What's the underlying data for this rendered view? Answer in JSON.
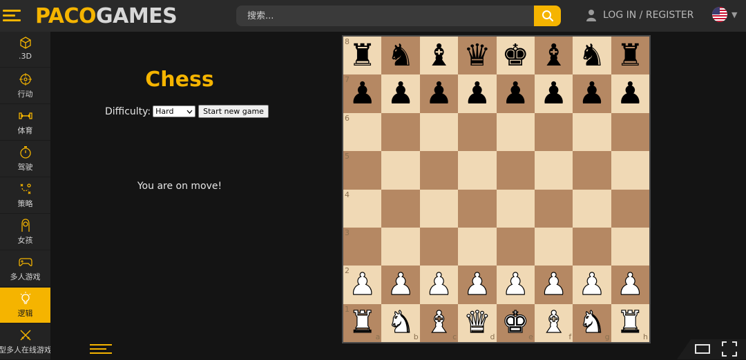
{
  "header": {
    "logo_paco": "PACO",
    "logo_games": "GAMES",
    "search_placeholder": "搜索...",
    "login_label": "LOG IN / REGISTER",
    "language": "English (US)"
  },
  "sidebar": {
    "items": [
      {
        "label": ".3D",
        "icon": "cube-icon",
        "active": false
      },
      {
        "label": "行动",
        "icon": "crosshair-icon",
        "active": false
      },
      {
        "label": "体育",
        "icon": "dumbbell-icon",
        "active": false
      },
      {
        "label": "驾驶",
        "icon": "stopwatch-icon",
        "active": false
      },
      {
        "label": "策略",
        "icon": "strategy-icon",
        "active": false
      },
      {
        "label": "女孩",
        "icon": "girl-icon",
        "active": false
      },
      {
        "label": "多人游戏",
        "icon": "gamepad-icon",
        "active": false
      },
      {
        "label": "逻辑",
        "icon": "lightbulb-icon",
        "active": true
      },
      {
        "label": "型多人在线游戏",
        "icon": "swords-icon",
        "active": false
      }
    ]
  },
  "game": {
    "title": "Chess",
    "difficulty_label": "Difficulty:",
    "difficulty_value": "Hard",
    "new_game_label": "Start new game",
    "status": "You are on move!"
  },
  "board": {
    "ranks": [
      "8",
      "7",
      "6",
      "5",
      "4",
      "3",
      "2",
      "1"
    ],
    "files": [
      "a",
      "b",
      "c",
      "d",
      "e",
      "f",
      "g",
      "h"
    ],
    "position": [
      [
        "br",
        "bn",
        "bb",
        "bq",
        "bk",
        "bb",
        "bn",
        "br"
      ],
      [
        "bp",
        "bp",
        "bp",
        "bp",
        "bp",
        "bp",
        "bp",
        "bp"
      ],
      [
        "",
        "",
        "",
        "",
        "",
        "",
        "",
        ""
      ],
      [
        "",
        "",
        "",
        "",
        "",
        "",
        "",
        ""
      ],
      [
        "",
        "",
        "",
        "",
        "",
        "",
        "",
        ""
      ],
      [
        "",
        "",
        "",
        "",
        "",
        "",
        "",
        ""
      ],
      [
        "wp",
        "wp",
        "wp",
        "wp",
        "wp",
        "wp",
        "wp",
        "wp"
      ],
      [
        "wr",
        "wn",
        "wb",
        "wq",
        "wk",
        "wb",
        "wn",
        "wr"
      ]
    ],
    "light_color": "#f0d9b5",
    "dark_color": "#b58863"
  },
  "colors": {
    "accent": "#f5b400",
    "topbar": "#2a2a2a",
    "sidebar": "#232323",
    "background": "#141414"
  }
}
